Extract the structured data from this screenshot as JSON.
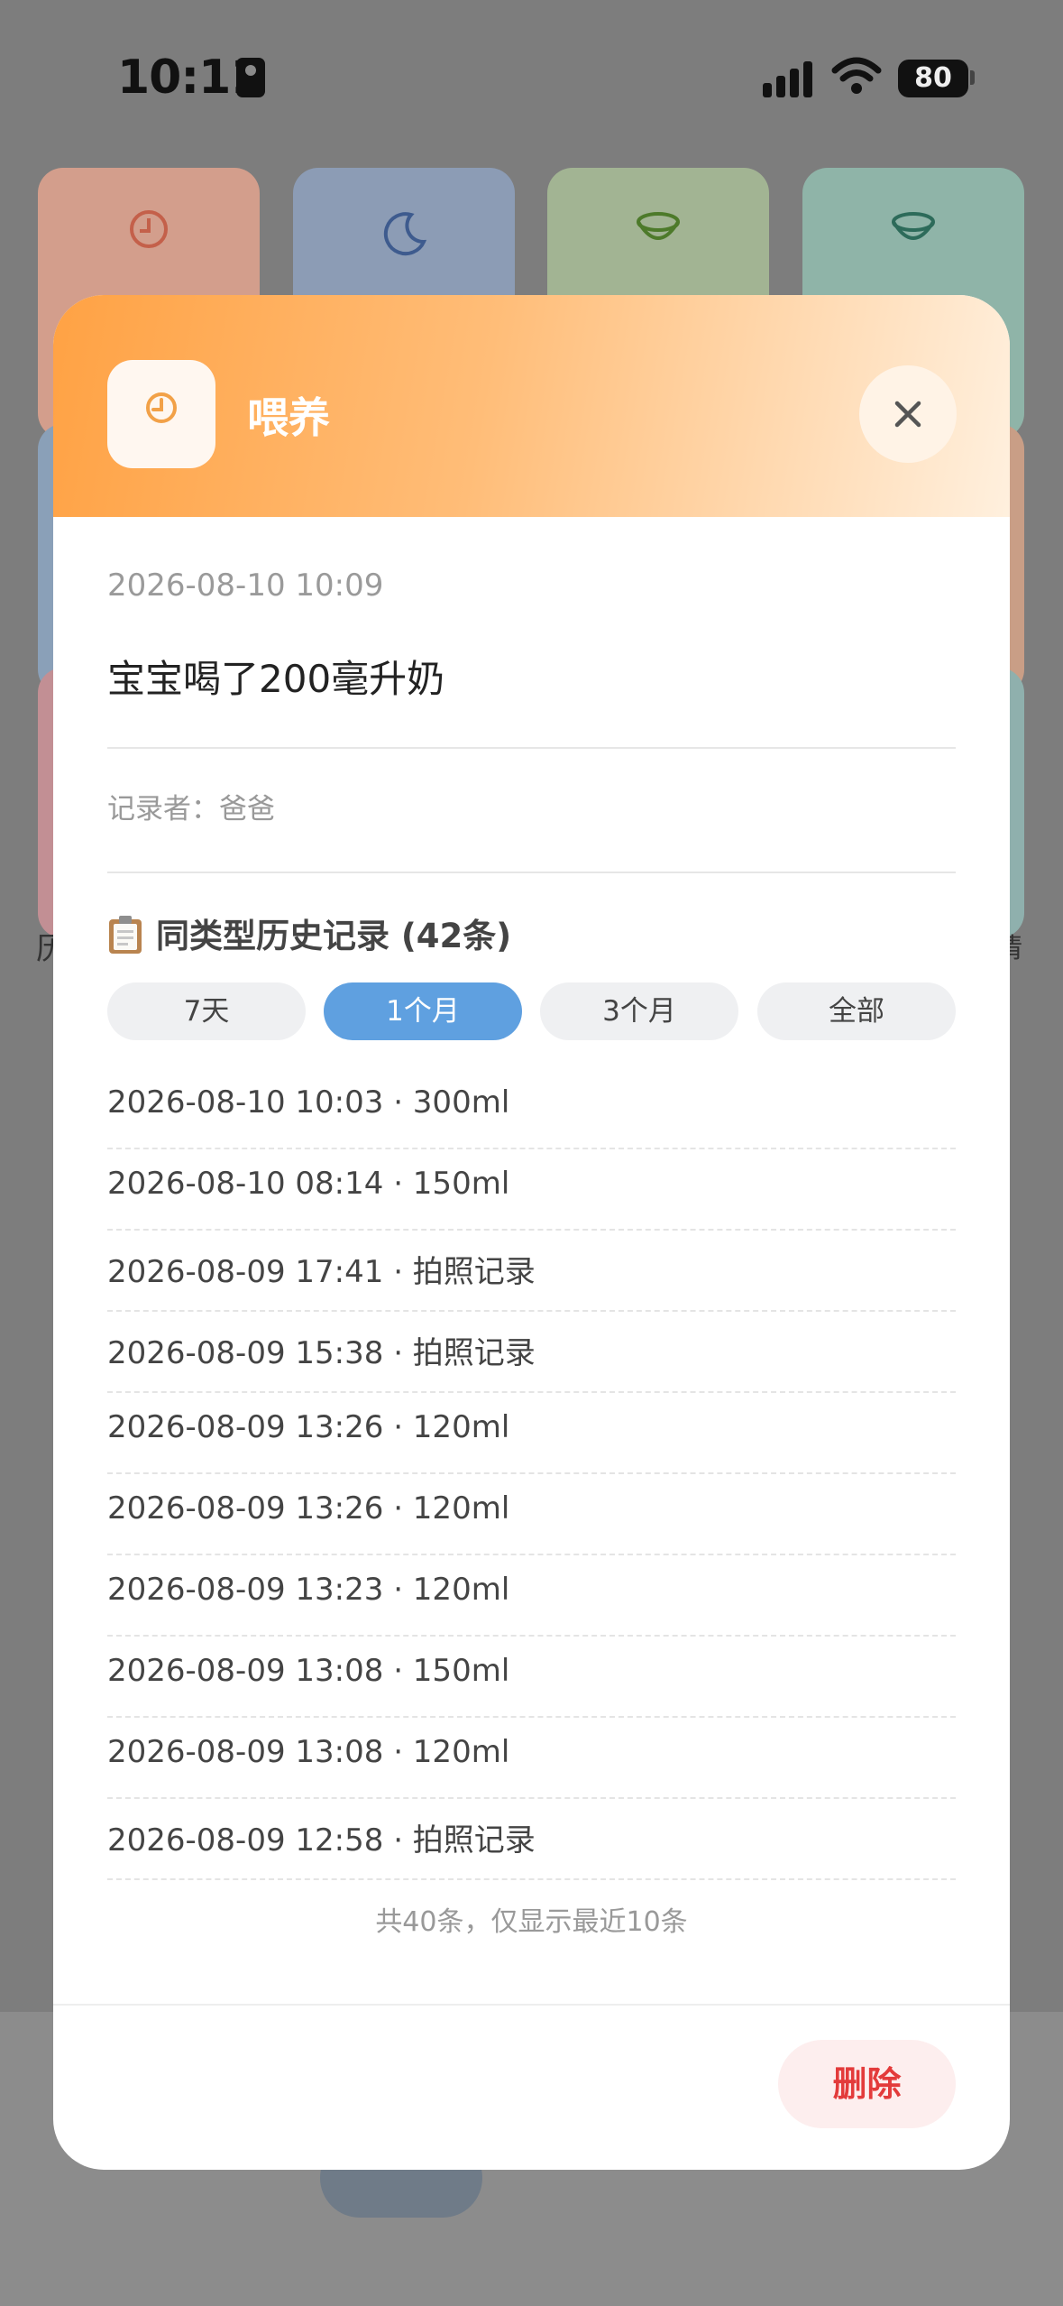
{
  "status_bar": {
    "time": "10:11",
    "battery": "80"
  },
  "background": {
    "section_label_left": "历",
    "section_label_right": "情",
    "tile_colors": [
      "#d39e8c",
      "#8c9cb5",
      "#a2b493",
      "#8fb4a8"
    ]
  },
  "modal": {
    "title": "喂养",
    "icon": "clock-icon",
    "datetime": "2026-08-10 10:09",
    "content": "宝宝喝了200毫升奶",
    "recorder_label": "记录者：",
    "recorder_name": "爸爸",
    "history": {
      "title": "同类型历史记录 (42条)",
      "icon": "clipboard-icon",
      "filters": [
        "7天",
        "1个月",
        "3个月",
        "全部"
      ],
      "active_filter": "1个月",
      "items": [
        "2026-08-10 10:03 · 300ml",
        "2026-08-10 08:14 · 150ml",
        "2026-08-09 17:41 · 拍照记录",
        "2026-08-09 15:38 · 拍照记录",
        "2026-08-09 13:26 · 120ml",
        "2026-08-09 13:26 · 120ml",
        "2026-08-09 13:23 · 120ml",
        "2026-08-09 13:08 · 150ml",
        "2026-08-09 13:08 · 120ml",
        "2026-08-09 12:58 · 拍照记录"
      ],
      "footnote": "共40条，仅显示最近10条"
    },
    "delete_label": "删除",
    "colors": {
      "header_start": "#ffa244",
      "header_end": "#fff0de",
      "active_filter": "#5fa0e0",
      "delete_text": "#e33b3b"
    }
  }
}
